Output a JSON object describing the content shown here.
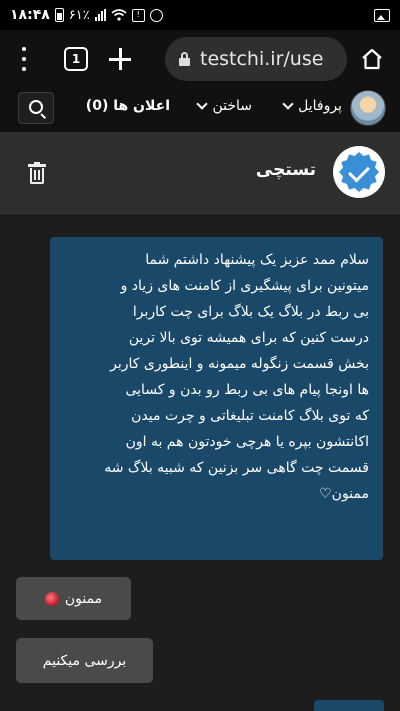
{
  "status_bar": {
    "time": "۱۸:۴۸",
    "battery": "۶۱٪"
  },
  "browser": {
    "url": "testchi.ir/use",
    "tab_count": "1"
  },
  "site_nav": {
    "profile_label": "پروفایل",
    "build_label": "ساختن",
    "ads_label": "اعلان ها (0)"
  },
  "chat": {
    "title": "تستچی"
  },
  "message": {
    "text": "سلام ممد عزیز یک پیشنهاد داشتم شما\nمیتونین برای پیشگیری از کامنت های زیاد و\nبی ربط در بلاگ یک بلاگ برای چت کاربرا\nدرست کنین که برای همیشه توی بالا ترین\nبخش قسمت زنگوله میمونه و اینطوری کاربر\nها اونجا پیام های بی ربط رو بدن و کسایی\nکه توی بلاگ کامنت تبلیغاتی و چرت میدن\nاکانتشون بپره یا هرچی خودتون هم به اون\nقسمت چت گاهی سر بزنین که شبیه بلاگ شه\nممنون♡"
  },
  "replies": [
    {
      "label": "ممنون"
    },
    {
      "label": "بررسی میکنیم"
    }
  ]
}
